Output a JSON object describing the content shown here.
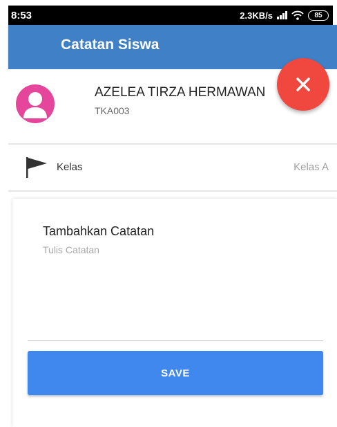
{
  "status_bar": {
    "time": "8:53",
    "network_speed": "2.3KB/s",
    "battery_level": "85",
    "icons": [
      "signal-icon",
      "wifi-icon",
      "battery-icon"
    ]
  },
  "app_bar": {
    "title": "Catatan Siswa",
    "color": "#3f80c6"
  },
  "close_fab": {
    "icon": "close-icon",
    "color": "#f0473f"
  },
  "student": {
    "name": "AZELEA TIRZA HERMAWAN",
    "id": "TKA003",
    "avatar_icon": "person-icon",
    "avatar_color": "#e5459a"
  },
  "kelas": {
    "icon": "flag-icon",
    "label": "Kelas",
    "value": "Kelas A"
  },
  "note": {
    "title": "Tambahkan Catatan",
    "placeholder": "Tulis Catatan",
    "value": ""
  },
  "save_button": {
    "label": "SAVE",
    "color": "#4188ee"
  }
}
